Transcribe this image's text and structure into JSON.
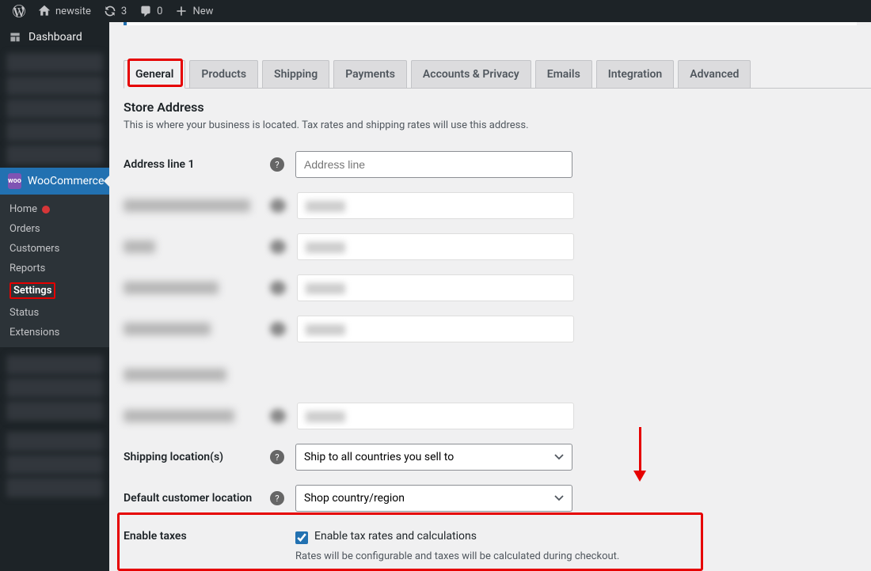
{
  "adminbar": {
    "site_name": "newsite",
    "updates_count": "3",
    "comments_count": "0",
    "new_label": "New"
  },
  "sidebar": {
    "dashboard": "Dashboard",
    "woocommerce": "WooCommerce",
    "submenu": {
      "home": "Home",
      "orders": "Orders",
      "customers": "Customers",
      "reports": "Reports",
      "settings": "Settings",
      "status": "Status",
      "extensions": "Extensions"
    }
  },
  "tabs": {
    "general": "General",
    "products": "Products",
    "shipping": "Shipping",
    "payments": "Payments",
    "accounts": "Accounts & Privacy",
    "emails": "Emails",
    "integration": "Integration",
    "advanced": "Advanced"
  },
  "section": {
    "heading": "Store Address",
    "description": "This is where your business is located. Tax rates and shipping rates will use this address."
  },
  "form": {
    "address1_label": "Address line 1",
    "address1_placeholder": "Address line",
    "shipping_loc_label": "Shipping location(s)",
    "shipping_loc_value": "Ship to all countries you sell to",
    "default_loc_label": "Default customer location",
    "default_loc_value": "Shop country/region",
    "enable_taxes_label": "Enable taxes",
    "enable_taxes_checkbox": "Enable tax rates and calculations",
    "enable_taxes_desc": "Rates will be configurable and taxes will be calculated during checkout.",
    "help_char": "?"
  }
}
